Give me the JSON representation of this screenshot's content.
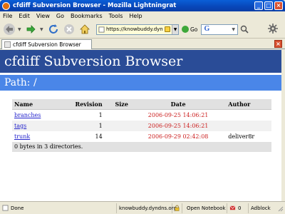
{
  "window": {
    "title": "cfdiff Subversion Browser - Mozilla Lightningrat",
    "buttons": {
      "minimize": "_",
      "maximize": "□",
      "close": "×"
    }
  },
  "menu": [
    "File",
    "Edit",
    "View",
    "Go",
    "Bookmarks",
    "Tools",
    "Help"
  ],
  "toolbar": {
    "url": "https://knowbuddy.dyndn",
    "go_label": "Go",
    "search_logo": "G"
  },
  "tab": {
    "label": "cfdiff Subversion Browser"
  },
  "page": {
    "header": "cfdiff Subversion Browser",
    "path": "Path: /",
    "columns": [
      "Name",
      "Revision",
      "Size",
      "Date",
      "Author"
    ],
    "rows": [
      {
        "name": "branches",
        "revision": "1",
        "size": "",
        "date": "2006-09-25 14:06:21",
        "author": ""
      },
      {
        "name": "tags",
        "revision": "1",
        "size": "",
        "date": "2006-09-25 14:06:21",
        "author": ""
      },
      {
        "name": "trunk",
        "revision": "14",
        "size": "",
        "date": "2006-09-29 02:42:08",
        "author": "deliver8r"
      }
    ],
    "summary": "0 bytes in 3 directories."
  },
  "status": {
    "done": "Done",
    "host": "knowbuddy.dyndns.org",
    "notebook": "Open Notebook",
    "mail": "0",
    "adblock": "Adblock"
  },
  "colors": {
    "header_bg": "#2a4c97",
    "path_bg": "#4a86e8",
    "link": "#2222cc",
    "date": "#cc2222"
  }
}
